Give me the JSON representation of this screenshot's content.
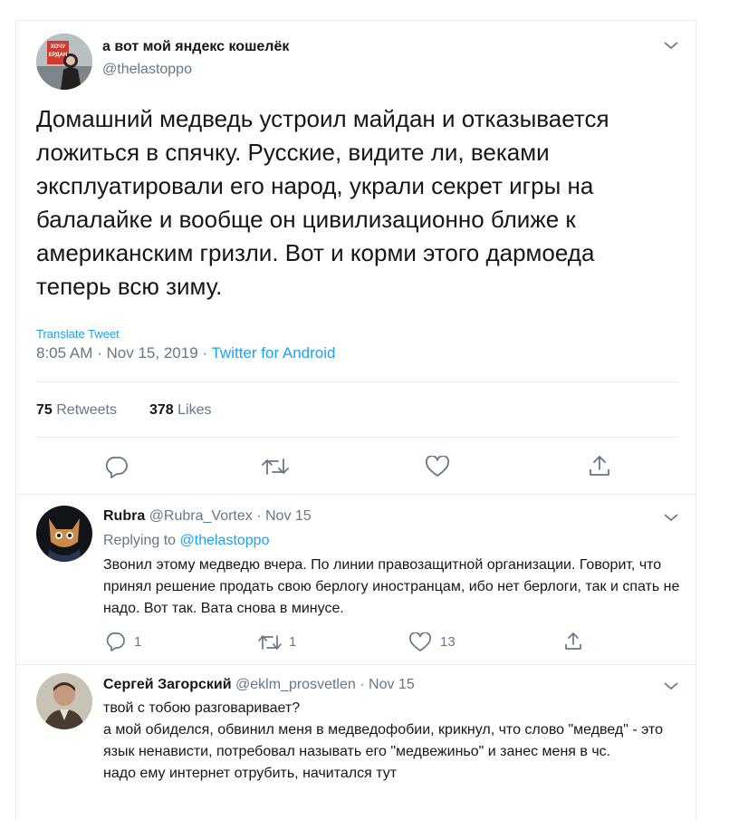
{
  "main": {
    "display_name": "а вот мой яндекс кошелёк",
    "handle": "@thelastoppo",
    "text": "Домашний медведь устроил майдан и отказывается ложиться в спячку. Русские, видите ли, веками эксплуатировали его народ, украли секрет игры на балалайке и вообще он цивилизационно ближе к американским гризли. Вот и корми этого дармоеда теперь всю зиму.",
    "translate_label": "Translate Tweet",
    "time": "8:05 AM",
    "date": "Nov 15, 2019",
    "sep": "·",
    "source": "Twitter for Android",
    "retweets_count": "75",
    "retweets_label": "Retweets",
    "likes_count": "378",
    "likes_label": "Likes",
    "avatar_sign_text": "ХОЧУ ЕРДАН"
  },
  "replies": [
    {
      "display_name": "Rubra",
      "handle": "@Rubra_Vortex",
      "sep": "·",
      "date": "Nov 15",
      "replying_label": "Replying to",
      "replying_handle": "@thelastoppo",
      "text": "Звонил этому медведю вчера. По линии правозащитной организации. Говорит, что принял решение продать свою берлогу иностранцам, ибо нет берлоги, так и спать не надо. Вот так. Вата снова в минусе.",
      "reply_count": "1",
      "retweet_count": "1",
      "like_count": "13"
    },
    {
      "display_name": "Сергей Загорский",
      "handle": "@eklm_prosvetlen",
      "sep": "·",
      "date": "Nov 15",
      "lines": [
        "твой с тобою разговаривает?",
        "а мой обиделся, обвинил меня в медведофобии, крикнул, что слово \"медвед\" - это язык ненависти, потребовал называть его \"медвежиньо\" и занес меня в чс.",
        "надо ему интернет отрубить, начитался тут"
      ]
    }
  ],
  "colors": {
    "link": "#1da1f2",
    "secondary": "#657786",
    "text": "#14171a",
    "divider": "#e6ecf0"
  },
  "icons": {
    "chevron": "chevron-down-icon",
    "reply": "reply-icon",
    "retweet": "retweet-icon",
    "like": "heart-icon",
    "share": "share-icon"
  }
}
